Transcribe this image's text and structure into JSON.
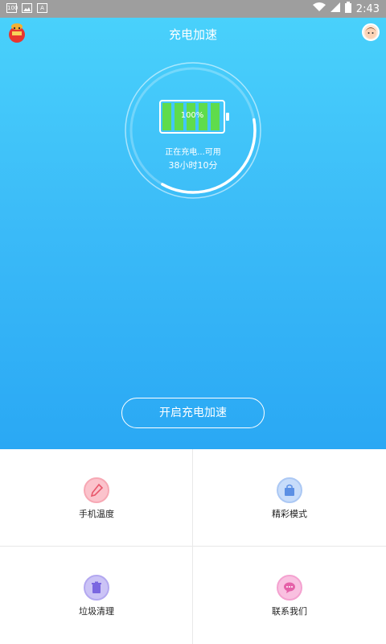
{
  "statusbar": {
    "left_icons": [
      "100",
      "image-icon",
      "A"
    ],
    "time": "2:43"
  },
  "header": {
    "title": "充电加速"
  },
  "battery": {
    "percent_label": "100%",
    "charging_text": "正在充电...可用",
    "remaining_text": "38小时10分",
    "level": 1.0,
    "ring_progress": 0.36
  },
  "actions": {
    "boost_label": "开启充电加速"
  },
  "tiles": [
    {
      "label": "手机温度",
      "icon": "thermometer-icon",
      "color": "#f47b8b"
    },
    {
      "label": "精彩模式",
      "icon": "bag-icon",
      "color": "#7aa7ee"
    },
    {
      "label": "垃圾清理",
      "icon": "trash-icon",
      "color": "#8c7be8"
    },
    {
      "label": "联系我们",
      "icon": "chat-icon",
      "color": "#f07ab8"
    }
  ],
  "colors": {
    "accent": "#3cbcf8",
    "battery_green": "#5fdc4c"
  }
}
